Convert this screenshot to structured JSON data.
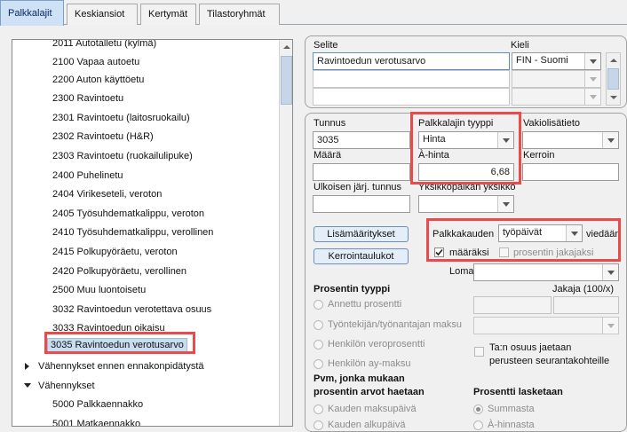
{
  "tabs": [
    {
      "label": "Palkkalajit",
      "active": true
    },
    {
      "label": "Keskiansiot",
      "active": false
    },
    {
      "label": "Kertymät",
      "active": false
    },
    {
      "label": "Tilastoryhmät",
      "active": false
    }
  ],
  "tree": {
    "items": [
      {
        "label": "2011 Autotalletu (kylmä)",
        "selected": false
      },
      {
        "label": "2100 Vapaa autoetu",
        "selected": false
      },
      {
        "label": "2200 Auton käyttöetu",
        "selected": false
      },
      {
        "label": "2300 Ravintoetu",
        "selected": false
      },
      {
        "label": "2301 Ravintoetu (laitosruokailu)",
        "selected": false
      },
      {
        "label": "2302 Ravintoetu (H&R)",
        "selected": false
      },
      {
        "label": "2303 Ravintoetu (ruokailulipuke)",
        "selected": false
      },
      {
        "label": "2400 Puhelinetu",
        "selected": false
      },
      {
        "label": "2404 Virikeseteli, veroton",
        "selected": false
      },
      {
        "label": "2405 Työsuhdematkalippu, veroton",
        "selected": false
      },
      {
        "label": "2410 Työsuhdematkalippu, verollinen",
        "selected": false
      },
      {
        "label": "2415 Polkupyöräetu, veroton",
        "selected": false
      },
      {
        "label": "2420 Polkupyöräetu, verollinen",
        "selected": false
      },
      {
        "label": "2500 Muu luontoisetu",
        "selected": false
      },
      {
        "label": "3032 Ravintoedun verotettava osuus",
        "selected": false
      },
      {
        "label": "3033 Ravintoedun oikaisu",
        "selected": false
      },
      {
        "label": "3035 Ravintoedun verotusarvo",
        "selected": true
      }
    ],
    "groups": [
      {
        "label": "Vähennykset ennen ennakonpidätystä",
        "expanded": false
      },
      {
        "label": "Vähennykset",
        "expanded": true
      }
    ],
    "children": [
      {
        "label": "5000 Palkkaennakko"
      },
      {
        "label": "5001 Matkaennakko"
      }
    ]
  },
  "selite_panel": {
    "selite_label": "Selite",
    "kieli_label": "Kieli",
    "selite_value": "Ravintoedun verotusarvo",
    "kieli_value": "FIN - Suomi"
  },
  "form": {
    "tunnus_label": "Tunnus",
    "tunnus_value": "3035",
    "tyyppi_label": "Palkkalajin tyyppi",
    "tyyppi_value": "Hinta",
    "vakio_label": "Vakiolisätieto",
    "vakio_value": "",
    "maara_label": "Määrä",
    "maara_value": "",
    "ahinta_label": "À-hinta",
    "ahinta_value": "6,68",
    "kerroin_label": "Kerroin",
    "kerroin_value": "",
    "ulkoinen_label": "Ulkoisen järj. tunnus",
    "ulkoinen_value": "",
    "yksikko_label": "Yksikköpalkan yksikkö",
    "yksikko_value": ""
  },
  "buttons": {
    "lisamaaritykset": "Lisämääritykset",
    "kerrointaulukot": "Kerrointaulukot"
  },
  "palkkakausi": {
    "prefix": "Palkkakauden",
    "value": "työpäivät",
    "suffix": "viedään",
    "maaraksi_label": "määräksi",
    "maaraksi_checked": true,
    "jakajaksi_label": "prosentin jakajaksi",
    "jakajaksi_checked": false
  },
  "loma": {
    "label": "Loma",
    "value": ""
  },
  "prosentti": {
    "title": "Prosentin tyyppi",
    "jakaja_label": "Jakaja (100/x)",
    "options": [
      {
        "label": "Annettu prosentti"
      },
      {
        "label": "Työntekijän/työnantajan maksu"
      },
      {
        "label": "Henkilön veroprosentti"
      },
      {
        "label": "Henkilön ay-maksu"
      }
    ],
    "osuus_label_1": "Ta:n osuus jaetaan",
    "osuus_label_2": "perusteen seurantakohteille"
  },
  "pvm": {
    "title_1": "Pvm, jonka mukaan",
    "title_2": "prosentin arvot haetaan",
    "options": [
      {
        "label": "Kauden maksupäivä",
        "selected": false
      },
      {
        "label": "Kauden alkupäivä",
        "selected": false
      }
    ]
  },
  "lasketaan": {
    "title": "Prosentti lasketaan",
    "options": [
      {
        "label": "Summasta",
        "selected": true
      },
      {
        "label": "À-hinnasta",
        "selected": false
      }
    ]
  },
  "colors": {
    "highlight_red": "#e84b4b",
    "selection_blue": "#c7ddf2",
    "active_tab": "#cfe2f5"
  }
}
